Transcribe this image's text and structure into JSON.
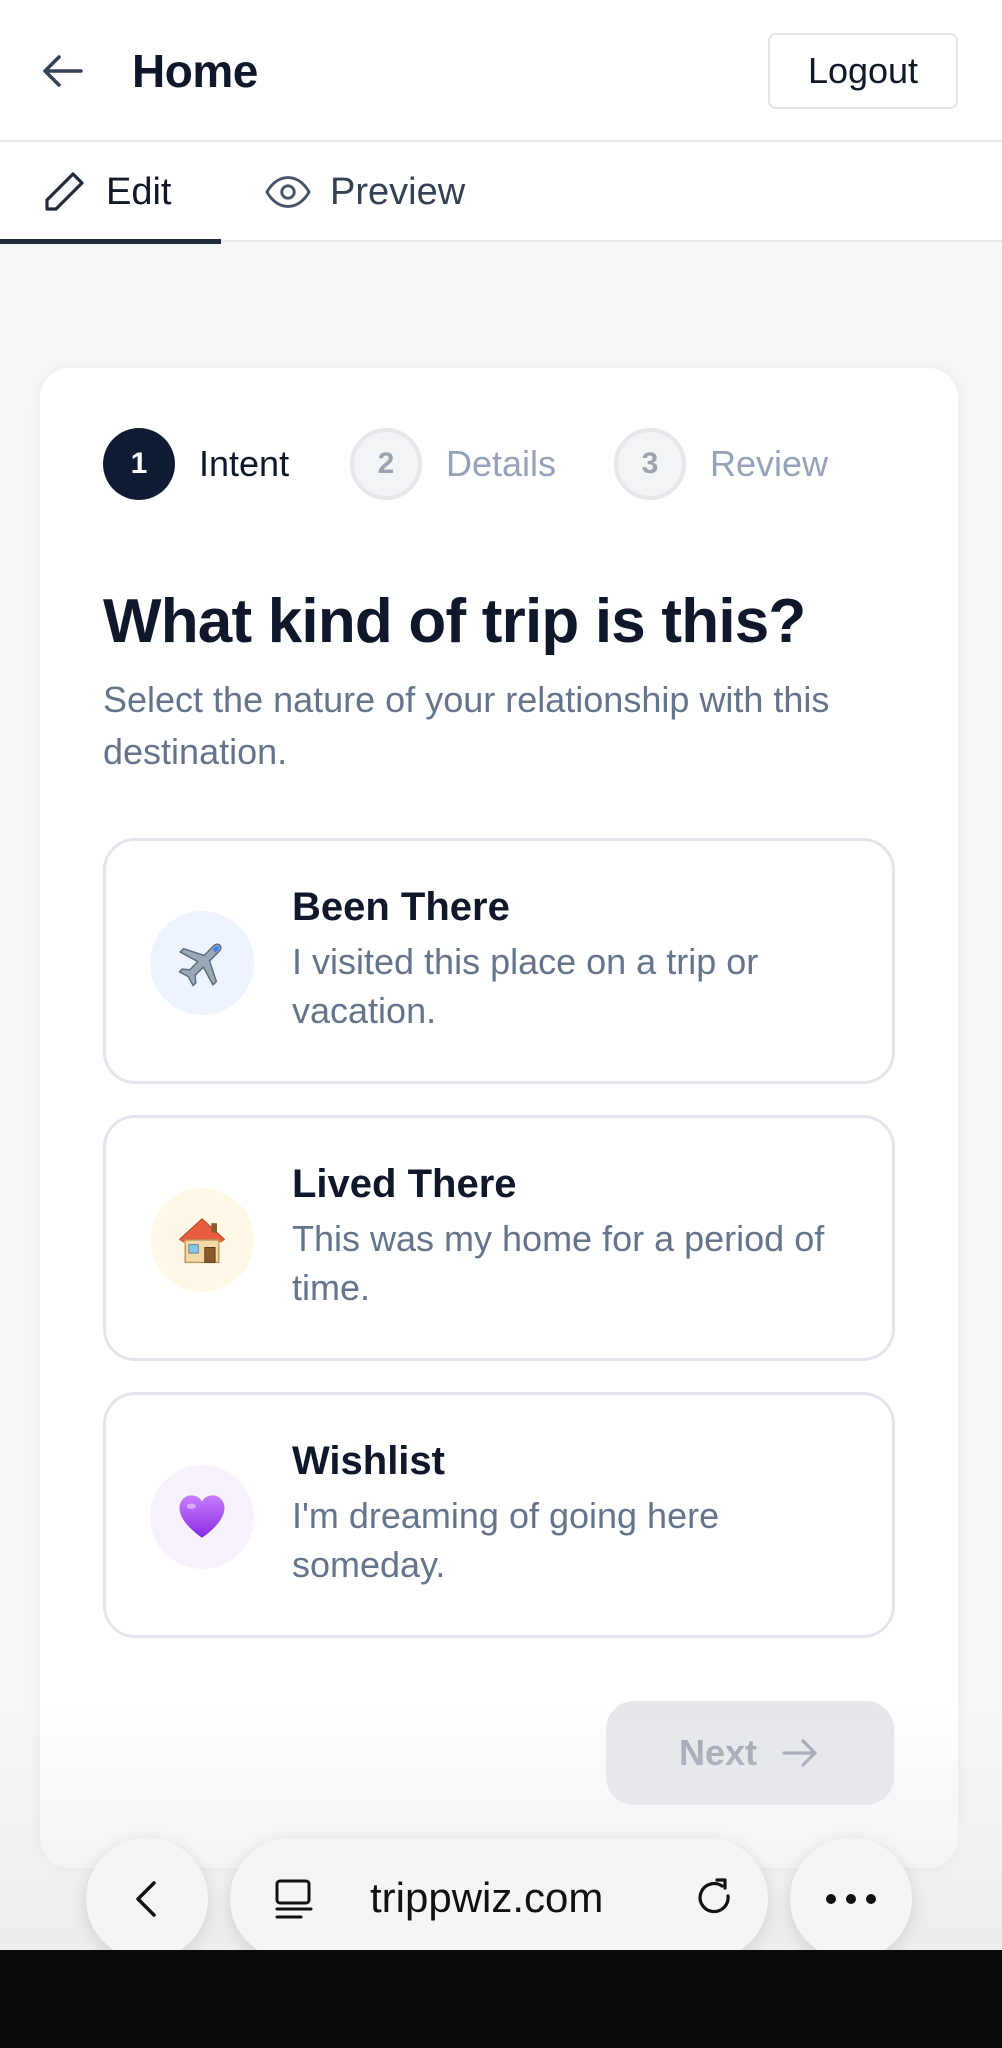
{
  "header": {
    "title": "Home",
    "logout_label": "Logout"
  },
  "tabs": [
    {
      "label": "Edit",
      "icon": "pencil-icon",
      "active": true
    },
    {
      "label": "Preview",
      "icon": "eye-icon",
      "active": false
    }
  ],
  "stepper": [
    {
      "number": "1",
      "label": "Intent",
      "active": true
    },
    {
      "number": "2",
      "label": "Details",
      "active": false
    },
    {
      "number": "3",
      "label": "Review",
      "active": false
    }
  ],
  "question": {
    "title": "What kind of trip is this?",
    "subtitle": "Select the nature of your relationship with this destination."
  },
  "options": [
    {
      "emoji": "✈️",
      "title": "Been There",
      "description": "I visited this place on a trip or vacation."
    },
    {
      "emoji": "🏠",
      "title": "Lived There",
      "description": "This was my home for a period of time."
    },
    {
      "emoji": "💜",
      "title": "Wishlist",
      "description": "I'm dreaming of going here someday."
    }
  ],
  "next_label": "Next",
  "browser": {
    "url": "trippwiz.com"
  },
  "colors": {
    "primary": "#0f1b33",
    "muted": "#64748b",
    "border": "#e2e6ec"
  }
}
